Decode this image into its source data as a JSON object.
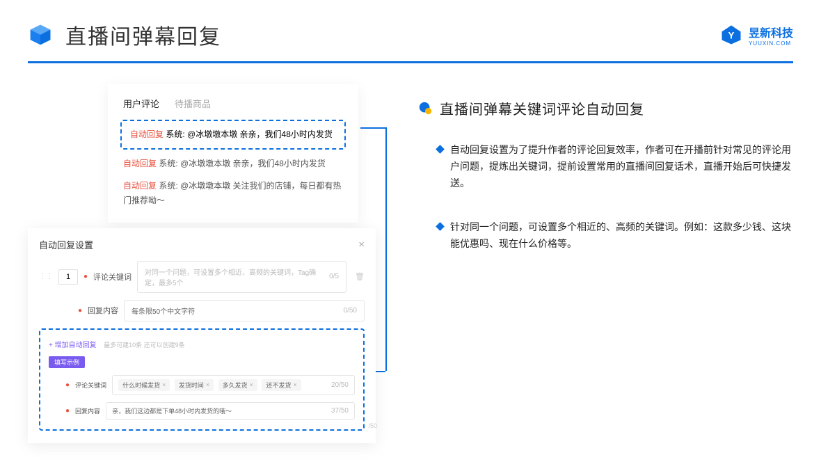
{
  "header": {
    "title": "直播间弹幕回复",
    "brand": "昱新科技",
    "brand_sub": "YUUXIN.COM"
  },
  "panel1": {
    "tab_active": "用户评论",
    "tab_inactive": "待播商品",
    "highlight_prefix": "自动回复",
    "highlight_text": "系统: @冰墩墩本墩 亲亲，我们48小时内发货",
    "line2_prefix": "自动回复",
    "line2_text": "系统: @冰墩墩本墩 亲亲，我们48小时内发货",
    "line3_prefix": "自动回复",
    "line3_text": "系统: @冰墩墩本墩 关注我们的店铺，每日都有热门推荐呦～"
  },
  "panel2": {
    "title": "自动回复设置",
    "num": "1",
    "kw_label": "评论关键词",
    "kw_placeholder": "对同一个问题，可设置多个相近、高频的关键词，Tag确定，最多5个",
    "kw_counter": "0/5",
    "content_label": "回复内容",
    "content_value": "每条限50个中文字符",
    "content_counter": "0/50",
    "add_link": "+ 增加自动回复",
    "add_hint": "最多可建10条 还可以创建9条",
    "example_badge": "填写示例",
    "ex_kw_label": "评论关键词",
    "ex_tags": [
      "什么时候发货",
      "发货时间",
      "多久发货",
      "还不发货"
    ],
    "ex_kw_counter": "20/50",
    "ex_content_label": "回复内容",
    "ex_content_value": "亲，我们这边都是下单48小时内发货的哦～",
    "ex_content_counter": "37/50",
    "outer_counter": "/50"
  },
  "right": {
    "section_title": "直播间弹幕关键词评论自动回复",
    "bullet1": "自动回复设置为了提升作者的评论回复效率，作者可在开播前针对常见的评论用户问题，提炼出关键词，提前设置常用的直播间回复话术，直播开始后可快捷发送。",
    "bullet2": "针对同一个问题，可设置多个相近的、高频的关键词。例如：这款多少钱、这块能优惠吗、现在什么价格等。"
  }
}
